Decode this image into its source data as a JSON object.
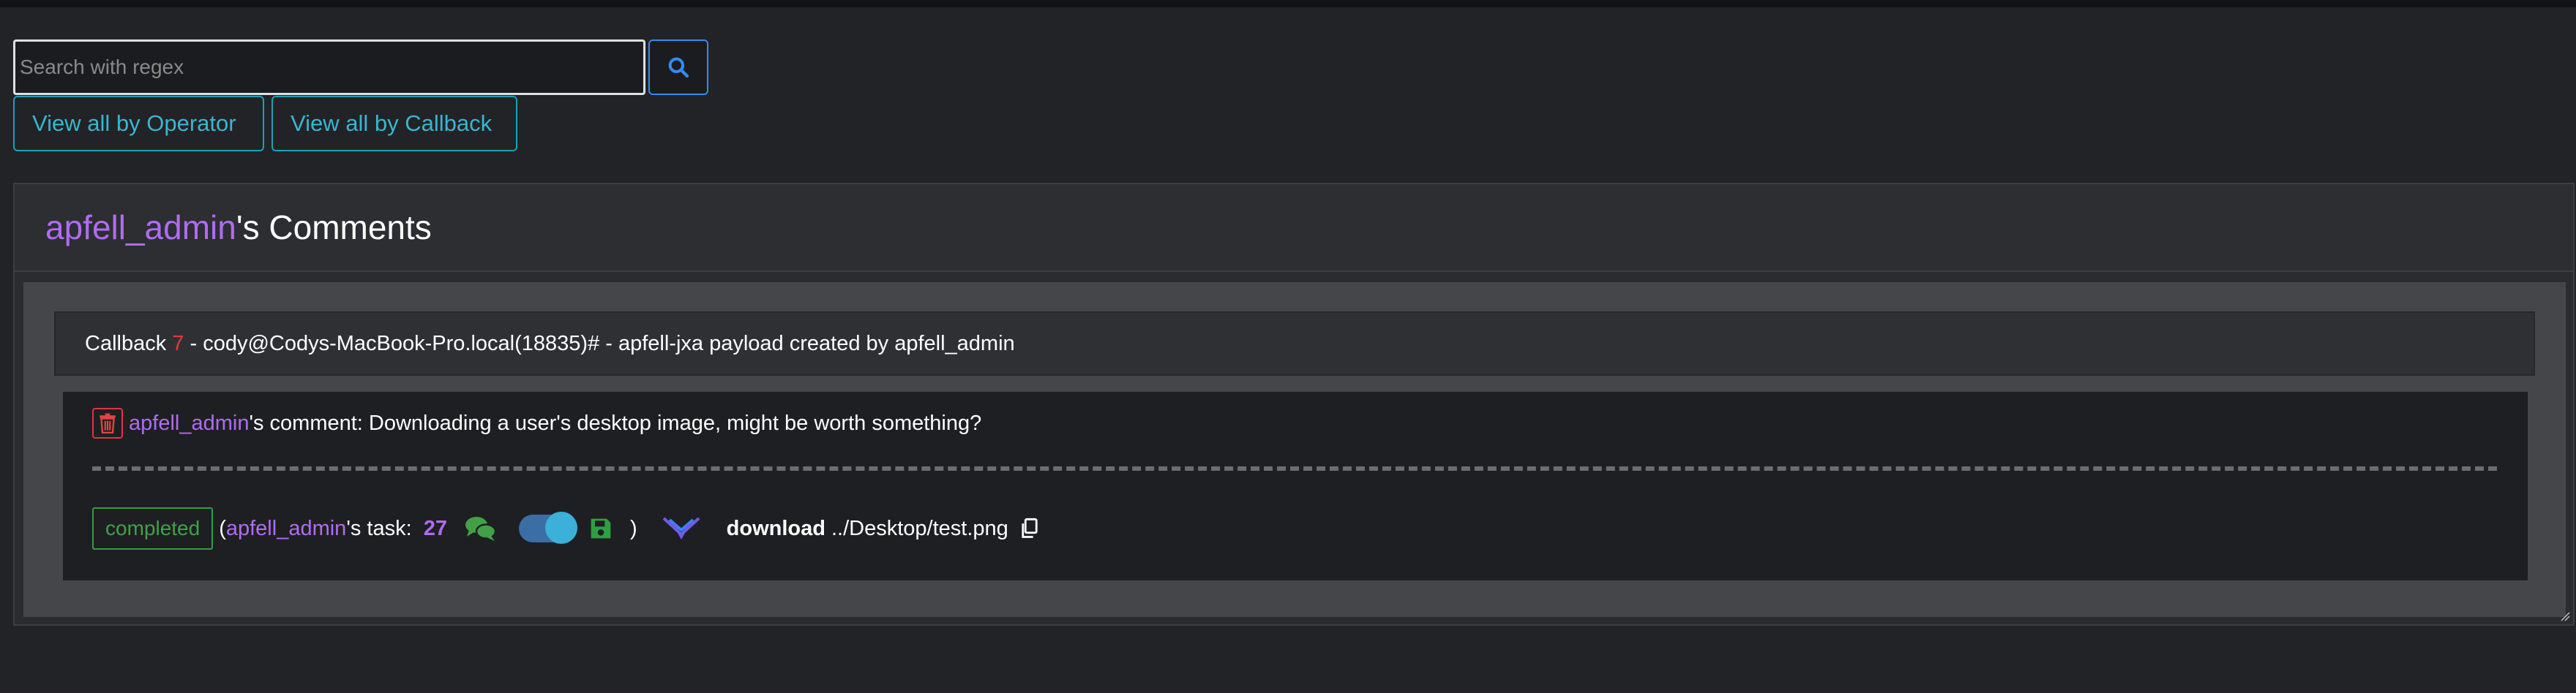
{
  "search": {
    "placeholder": "Search with regex"
  },
  "buttons": {
    "view_by_operator": "View all by Operator",
    "view_by_callback": "View all by Callback"
  },
  "header": {
    "username": "apfell_admin",
    "title_suffix": "'s Comments"
  },
  "callback": {
    "prefix": "Callback ",
    "id": "7",
    "description": " - cody@Codys-MacBook-Pro.local(18835)# - apfell-jxa payload created by apfell_admin"
  },
  "comment": {
    "author": "apfell_admin",
    "text": "'s comment: Downloading a user's desktop image, might be worth something?"
  },
  "task": {
    "status": "completed",
    "open_paren": "(",
    "operator": "apfell_admin",
    "label": "'s task: ",
    "number": "27",
    "close_paren": ")",
    "command": "download",
    "params": "../Desktop/test.png"
  },
  "icons": {
    "search": "search-icon",
    "trash": "trash-icon",
    "comments": "comments-icon",
    "toggle": "toggle-switch",
    "save": "save-icon",
    "expand": "double-chevron-down-icon",
    "copy": "copy-icon"
  },
  "colors": {
    "username": "#b06cf2",
    "callback_id": "#e23a3a",
    "status_completed": "#43a047",
    "info_accent": "#17a2b8",
    "primary_accent": "#2f8df5"
  }
}
